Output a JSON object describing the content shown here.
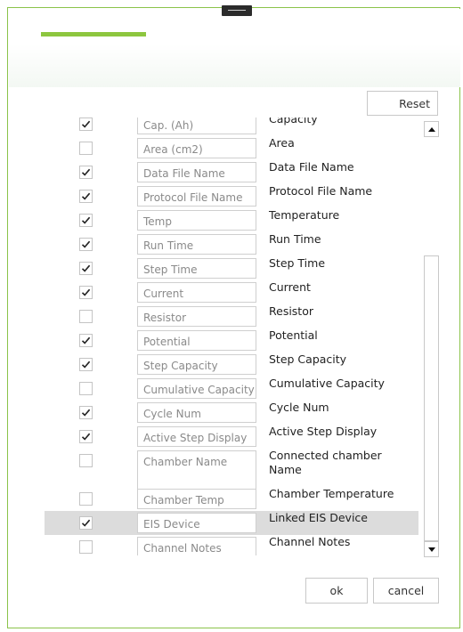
{
  "dialog": {
    "reset_label": "Reset",
    "ok_label": "ok",
    "cancel_label": "cancel"
  },
  "rows": [
    {
      "field": "Cap. (Ah)",
      "desc": "Capacity",
      "checked": true
    },
    {
      "field": "Area (cm2)",
      "desc": "Area",
      "checked": false
    },
    {
      "field": "Data File Name",
      "desc": "Data File Name",
      "checked": true
    },
    {
      "field": "Protocol File Name",
      "desc": "Protocol File Name",
      "checked": true
    },
    {
      "field": "Temp",
      "desc": "Temperature",
      "checked": true
    },
    {
      "field": "Run Time",
      "desc": "Run Time",
      "checked": true
    },
    {
      "field": "Step Time",
      "desc": "Step Time",
      "checked": true
    },
    {
      "field": "Current",
      "desc": "Current",
      "checked": true
    },
    {
      "field": "Resistor",
      "desc": "Resistor",
      "checked": false
    },
    {
      "field": "Potential",
      "desc": "Potential",
      "checked": true
    },
    {
      "field": "Step Capacity",
      "desc": "Step Capacity",
      "checked": true
    },
    {
      "field": "Cumulative Capacity",
      "desc": "Cumulative Capacity",
      "checked": false
    },
    {
      "field": "Cycle Num",
      "desc": "Cycle Num",
      "checked": true
    },
    {
      "field": "Active Step Display",
      "desc": "Active Step Display",
      "checked": true
    },
    {
      "field": "Chamber Name",
      "desc": "Connected chamber Name",
      "checked": false
    },
    {
      "field": "Chamber Temp",
      "desc": "Chamber Temperature",
      "checked": false
    },
    {
      "field": "EIS Device",
      "desc": "Linked EIS Device",
      "checked": true,
      "selected": true
    },
    {
      "field": "Channel Notes",
      "desc": "Channel Notes",
      "checked": false
    }
  ],
  "icons": {
    "check": "checkmark-icon",
    "scroll_up": "triangle-up-icon",
    "scroll_down": "triangle-down-icon",
    "drag": "drag-handle-icon"
  },
  "colors": {
    "accent": "#8dc63f",
    "border": "#8bc34a",
    "selected_row": "#dcdcdc"
  }
}
